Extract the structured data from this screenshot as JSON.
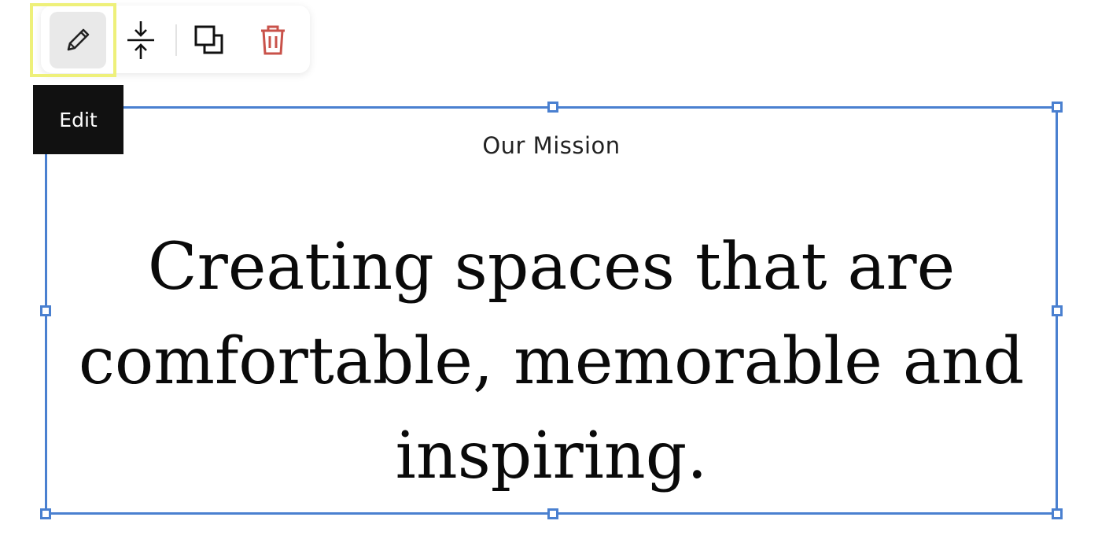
{
  "toolbar": {
    "buttons": [
      {
        "name": "edit",
        "icon": "pencil-icon",
        "selected": true
      },
      {
        "name": "fit",
        "icon": "vertical-collapse-icon"
      },
      {
        "name": "duplicate",
        "icon": "duplicate-icon"
      },
      {
        "name": "delete",
        "icon": "trash-icon",
        "color": "#c9524a"
      }
    ]
  },
  "tooltip": {
    "label": "Edit"
  },
  "text_block": {
    "eyebrow": "Our Mission",
    "headline": "Creating spaces that are comfortable, memorable and inspiring."
  },
  "colors": {
    "selection": "#4a80d0",
    "highlight": "#eef07a",
    "delete": "#c9524a"
  }
}
